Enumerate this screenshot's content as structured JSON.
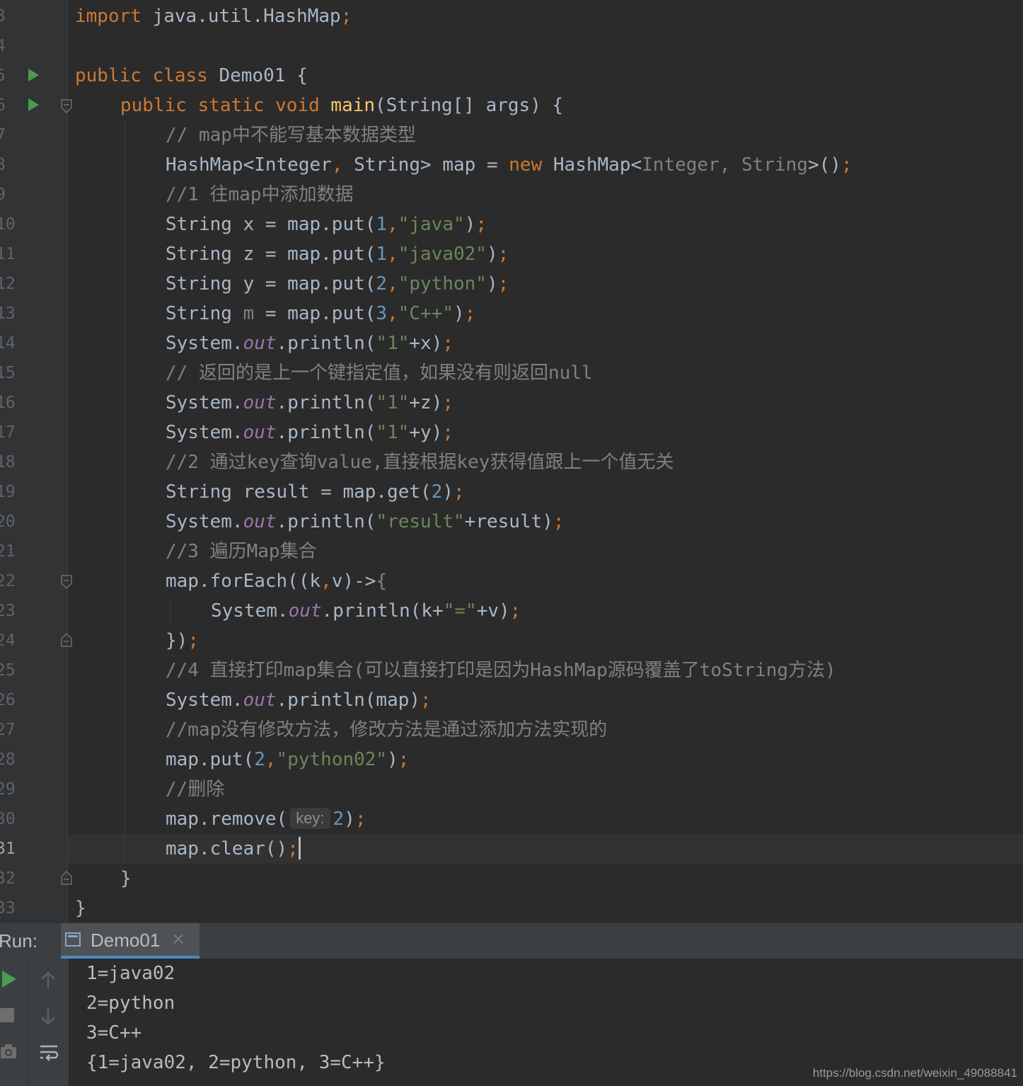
{
  "editor": {
    "line_numbers": [
      "3",
      "4",
      "5",
      "6",
      "7",
      "8",
      "9",
      "10",
      "11",
      "12",
      "13",
      "14",
      "15",
      "16",
      "17",
      "18",
      "19",
      "20",
      "21",
      "22",
      "23",
      "24",
      "25",
      "26",
      "27",
      "28",
      "29",
      "30",
      "31",
      "32",
      "33"
    ],
    "lines": {
      "l3": {
        "a": "import",
        "b": " java.util.HashMap",
        "c": ";"
      },
      "l5": {
        "a": "public class ",
        "b": "Demo01 {"
      },
      "l6": {
        "a": "public static void ",
        "b": "main",
        "c": "(String[] args) {"
      },
      "l7": {
        "cm": "// map中不能写基本数据类型"
      },
      "l8": {
        "a": "HashMap<Integer",
        "b": ", ",
        "c": "String> map = ",
        "d": "new ",
        "e": "HashMap<",
        "f": "Integer, String",
        "g": ">()",
        "h": ";"
      },
      "l9": {
        "cm": "//1 往map中添加数据"
      },
      "l10": {
        "a": "String x = map.put(",
        "n": "1",
        "c": ",",
        "s": "\"java\"",
        "e": ")",
        "f": ";"
      },
      "l11": {
        "a": "String z = map.put(",
        "n": "1",
        "c": ",",
        "s": "\"java02\"",
        "e": ")",
        "f": ";"
      },
      "l12": {
        "a": "String y = map.put(",
        "n": "2",
        "c": ",",
        "s": "\"python\"",
        "e": ")",
        "f": ";"
      },
      "l13": {
        "a": "String ",
        "g": "m",
        "b": " = map.put(",
        "n": "3",
        "c": ",",
        "s": "\"C++\"",
        "e": ")",
        "f": ";"
      },
      "l14": {
        "a": "System.",
        "o": "out",
        "b": ".println(",
        "s": "\"1\"",
        "c": "+x)",
        "f": ";"
      },
      "l15": {
        "cm": "// 返回的是上一个键指定值，如果没有则返回null"
      },
      "l16": {
        "a": "System.",
        "o": "out",
        "b": ".println(",
        "s": "\"1\"",
        "c": "+z)",
        "f": ";"
      },
      "l17": {
        "a": "System.",
        "o": "out",
        "b": ".println(",
        "s": "\"1\"",
        "c": "+y)",
        "f": ";"
      },
      "l18": {
        "cm": "//2 通过key查询value,直接根据key获得值跟上一个值无关"
      },
      "l19": {
        "a": "String result = map.get(",
        "n": "2",
        "c": ")",
        "f": ";"
      },
      "l20": {
        "a": "System.",
        "o": "out",
        "b": ".println(",
        "s": "\"result\"",
        "c": "+result)",
        "f": ";"
      },
      "l21": {
        "cm": "//3 遍历Map集合"
      },
      "l22": {
        "a": "map.forEach((k",
        "b": ",",
        "c": "v)->",
        "d": "{"
      },
      "l23": {
        "a": "System.",
        "o": "out",
        "b": ".println(k+",
        "s": "\"=\"",
        "c": "+v)",
        "f": ";"
      },
      "l24": {
        "a": "})",
        "f": ";"
      },
      "l25": {
        "cm": "//4 直接打印map集合(可以直接打印是因为HashMap源码覆盖了toString方法)"
      },
      "l26": {
        "a": "System.",
        "o": "out",
        "b": ".println(map)",
        "f": ";"
      },
      "l27": {
        "cm": "//map没有修改方法，修改方法是通过添加方法实现的"
      },
      "l28": {
        "a": "map.put(",
        "n": "2",
        "c": ",",
        "s": "\"python02\"",
        "e": ")",
        "f": ";"
      },
      "l29": {
        "cm": "//删除"
      },
      "l30": {
        "a": "map.remove(",
        "hint": "key:",
        "n": "2",
        "e": ")",
        "f": ";"
      },
      "l31": {
        "a": "map.clear()",
        "f": ";"
      },
      "l32": {
        "a": "}"
      },
      "l33": {
        "a": "}"
      }
    }
  },
  "run_panel": {
    "label": "Run:",
    "tab_label": "Demo01",
    "tab_close": "×",
    "output": [
      "1=java02",
      "2=python",
      "3=C++",
      "{1=java02, 2=python, 3=C++}"
    ]
  },
  "watermark": "https://blog.csdn.net/weixin_49088841",
  "icons": [
    "run-gutter-icon",
    "fold-icon",
    "rerun-icon",
    "stop-icon",
    "camera-icon",
    "scroll-up-icon",
    "scroll-down-icon",
    "soft-wrap-icon",
    "console-tab-icon"
  ],
  "colors": {
    "keyword": "#cc7832",
    "string": "#6a8759",
    "number": "#6897bb",
    "comment": "#808080",
    "field": "#9876aa",
    "method_decl": "#ffc66d",
    "text": "#a9b7c6",
    "background": "#2b2b2b"
  }
}
